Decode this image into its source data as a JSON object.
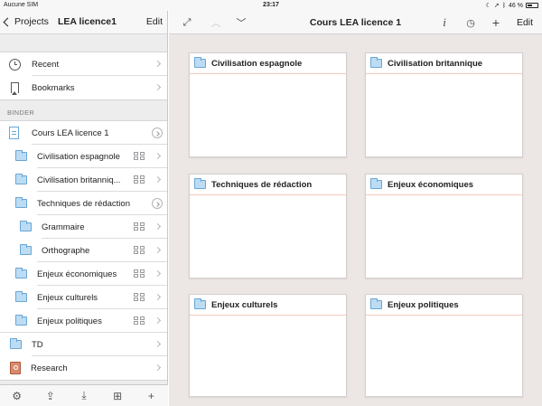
{
  "status": {
    "carrier": "Aucune SIM",
    "time": "23:17",
    "battery": "46 %"
  },
  "sidebar": {
    "back_label": "Projects",
    "title": "LEA licence1",
    "edit_label": "Edit",
    "top_items": [
      {
        "label": "Recent",
        "icon": "clock-icon"
      },
      {
        "label": "Bookmarks",
        "icon": "bookmark-icon"
      }
    ],
    "binder_header": "BINDER",
    "binder_items": [
      {
        "label": "Cours LEA licence 1",
        "icon": "document-icon",
        "indent": 0,
        "accessory": "circle-chevron"
      },
      {
        "label": "Civilisation espagnole",
        "icon": "folder-icon",
        "indent": 1,
        "accessory": "grid"
      },
      {
        "label": "Civilisation britanniq...",
        "icon": "folder-icon",
        "indent": 1,
        "accessory": "grid"
      },
      {
        "label": "Techniques de rédaction",
        "icon": "folder-icon",
        "indent": 1,
        "accessory": "circle-chevron"
      },
      {
        "label": "Grammaire",
        "icon": "folder-icon",
        "indent": 2,
        "accessory": "grid"
      },
      {
        "label": "Orthographe",
        "icon": "folder-icon",
        "indent": 2,
        "accessory": "grid"
      },
      {
        "label": "Enjeux économiques",
        "icon": "folder-icon",
        "indent": 1,
        "accessory": "grid"
      },
      {
        "label": "Enjeux culturels",
        "icon": "folder-icon",
        "indent": 1,
        "accessory": "grid"
      },
      {
        "label": "Enjeux politiques",
        "icon": "folder-icon",
        "indent": 1,
        "accessory": "grid"
      },
      {
        "label": "TD",
        "icon": "folder-icon",
        "indent": 0,
        "accessory": "chevron"
      },
      {
        "label": "Research",
        "icon": "research-book-icon",
        "indent": 0,
        "accessory": "chevron"
      }
    ],
    "bottom_toolbar": [
      "settings-icon",
      "share-icon",
      "import-icon",
      "add-folder-icon",
      "add-icon"
    ]
  },
  "main": {
    "title": "Cours LEA licence 1",
    "edit_label": "Edit",
    "cards": [
      {
        "title": "Civilisation espagnole"
      },
      {
        "title": "Civilisation britannique"
      },
      {
        "title": "Techniques de rédaction"
      },
      {
        "title": "Enjeux économiques"
      },
      {
        "title": "Enjeux culturels"
      },
      {
        "title": "Enjeux politiques"
      }
    ]
  },
  "colors": {
    "accent_folder": "#6aa6d4",
    "card_rule": "#f1c9bf",
    "corkboard_bg": "#ece6e4"
  }
}
